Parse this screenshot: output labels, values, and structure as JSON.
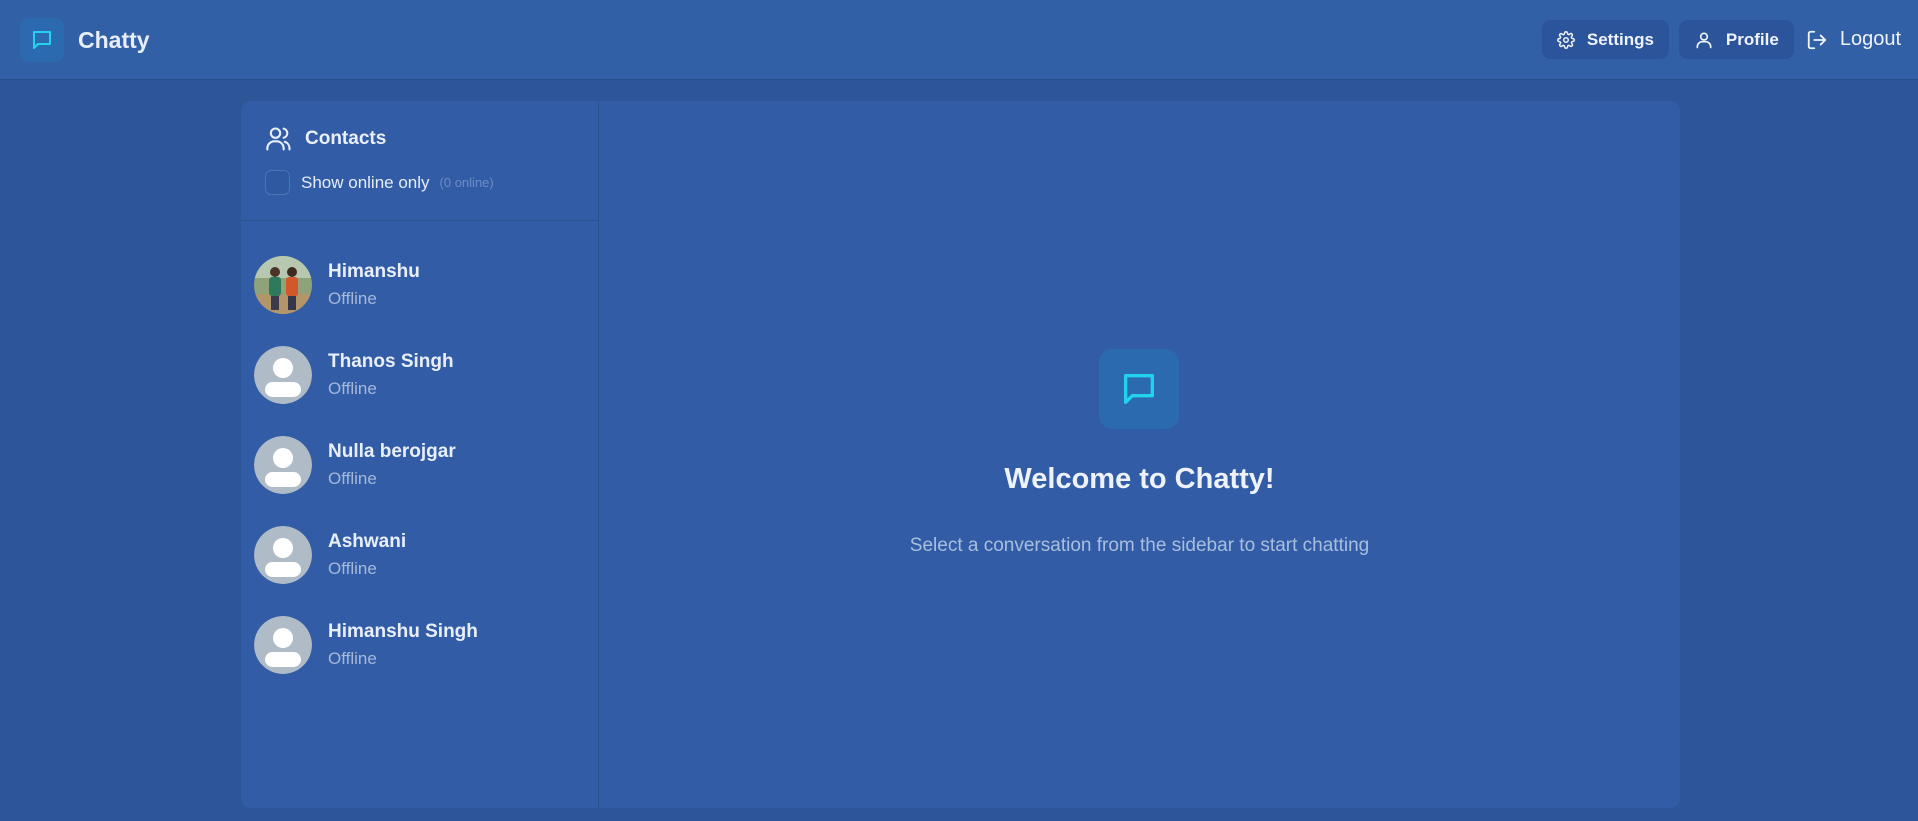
{
  "app": {
    "name": "Chatty"
  },
  "nav": {
    "settings_label": "Settings",
    "profile_label": "Profile",
    "logout_label": "Logout"
  },
  "sidebar": {
    "title": "Contacts",
    "filter_label": "Show online only",
    "online_count": "(0 online)",
    "contacts": [
      {
        "name": "Himanshu",
        "status": "Offline",
        "avatar": "photo"
      },
      {
        "name": "Thanos Singh",
        "status": "Offline",
        "avatar": "default"
      },
      {
        "name": "Nulla berojgar",
        "status": "Offline",
        "avatar": "default"
      },
      {
        "name": "Ashwani",
        "status": "Offline",
        "avatar": "default"
      },
      {
        "name": "Himanshu Singh",
        "status": "Offline",
        "avatar": "default"
      }
    ]
  },
  "welcome": {
    "title": "Welcome to Chatty!",
    "subtitle": "Select a conversation from the sidebar to start chatting"
  },
  "colors": {
    "accent": "#22d3ee",
    "background": "#2d5699",
    "panel": "#325da6"
  }
}
